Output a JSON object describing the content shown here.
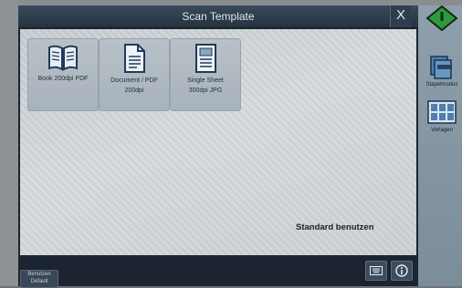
{
  "window": {
    "title": "Scan Template",
    "close_label": "X"
  },
  "templates": [
    {
      "label": "Book 200dpi PDF",
      "sub": "",
      "icon": "book-icon"
    },
    {
      "label": "Document / PDF",
      "sub": "200dpi",
      "icon": "document-icon"
    },
    {
      "label": "Single Sheet",
      "sub": "300dpi JPG",
      "icon": "single-sheet-icon"
    }
  ],
  "main": {
    "standard_label": "Standard benutzen"
  },
  "bottom": {
    "default_button": "Benutzen\nDefault",
    "icon_buttons": [
      "keyboard-icon",
      "info-icon"
    ]
  },
  "side_panel": {
    "status_icon": "status-diamond-icon",
    "apps": [
      {
        "label": "Stapelmodus",
        "icon": "stack-mode-icon"
      },
      {
        "label": "Vorlagen",
        "icon": "templates-icon"
      }
    ]
  },
  "colors": {
    "title_bar": "#2c3946",
    "tile": "#aeb8c0",
    "status_green": "#2e9a3e"
  }
}
